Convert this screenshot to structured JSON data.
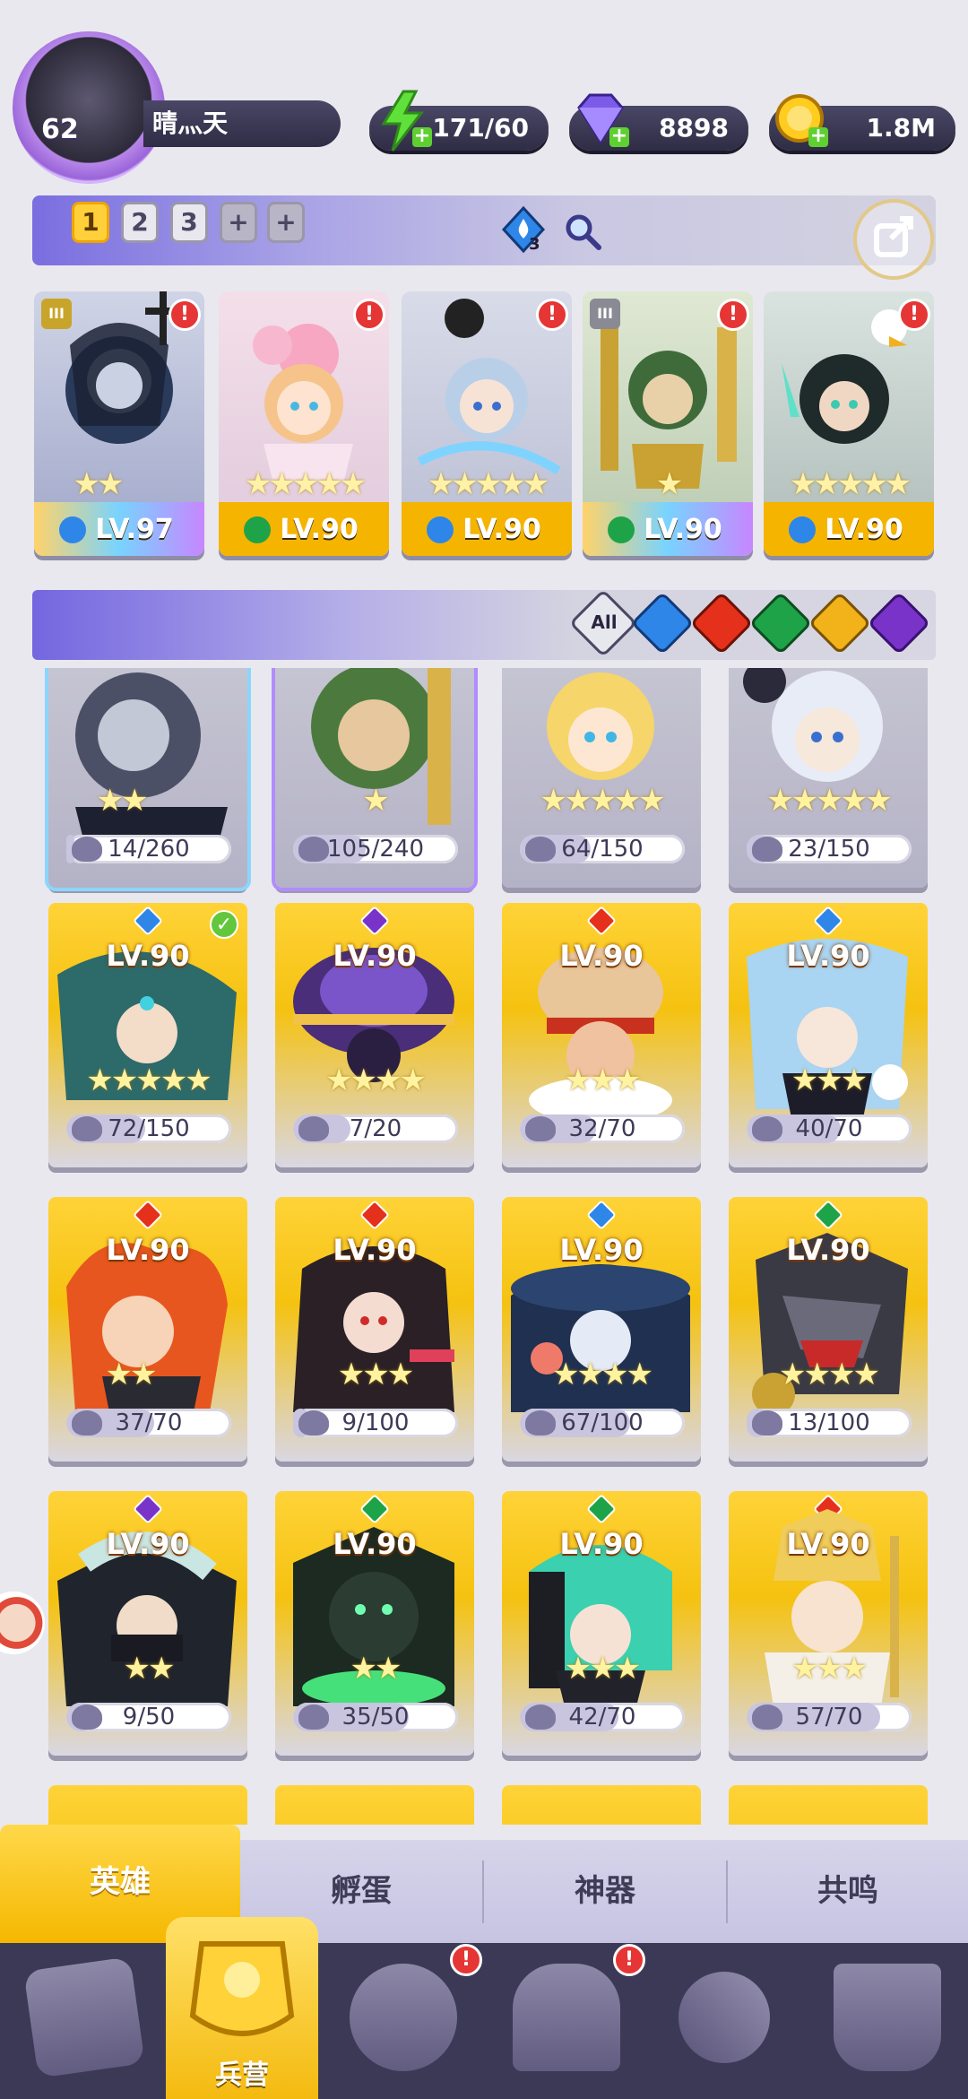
{
  "player": {
    "level": "62",
    "name": "晴灬天"
  },
  "resources": {
    "energy": "171/60",
    "gems": "8898",
    "gold": "1.8M"
  },
  "team_tabs": [
    "1",
    "2",
    "3",
    "+",
    "+"
  ],
  "filter_count": "3",
  "team": [
    {
      "level": "LV.97",
      "element": "water",
      "stars": 2,
      "alert": "!",
      "grade": "III"
    },
    {
      "level": "LV.90",
      "element": "wood",
      "stars": 5,
      "alert": "!"
    },
    {
      "level": "LV.90",
      "element": "water",
      "stars": 5,
      "alert": "!"
    },
    {
      "level": "LV.90",
      "element": "wood",
      "stars": 1,
      "alert": "!",
      "grade": "III"
    },
    {
      "level": "LV.90",
      "element": "water",
      "stars": 5,
      "alert": "!"
    }
  ],
  "element_filters": [
    "All",
    "water",
    "fire",
    "wood",
    "light",
    "dark"
  ],
  "heroes_top_row": [
    {
      "count": "14/260",
      "stars": 2
    },
    {
      "count": "105/240",
      "stars": 1
    },
    {
      "count": "64/150",
      "stars": 5
    },
    {
      "count": "23/150",
      "stars": 5
    }
  ],
  "heroes": [
    {
      "level": "LV.90",
      "element": "water",
      "count": "72/150",
      "stars": 5,
      "check": true
    },
    {
      "level": "LV.90",
      "element": "dark",
      "count": "7/20",
      "stars": 4
    },
    {
      "level": "LV.90",
      "element": "fire",
      "count": "32/70",
      "stars": 3
    },
    {
      "level": "LV.90",
      "element": "water",
      "count": "40/70",
      "stars": 3
    },
    {
      "level": "LV.90",
      "element": "fire",
      "count": "37/70",
      "stars": 2
    },
    {
      "level": "LV.90",
      "element": "fire",
      "count": "9/100",
      "stars": 3
    },
    {
      "level": "LV.90",
      "element": "water",
      "count": "67/100",
      "stars": 4
    },
    {
      "level": "LV.90",
      "element": "wood",
      "count": "13/100",
      "stars": 4
    },
    {
      "level": "LV.90",
      "element": "dark",
      "count": "9/50",
      "stars": 2
    },
    {
      "level": "LV.90",
      "element": "wood",
      "count": "35/50",
      "stars": 2
    },
    {
      "level": "LV.90",
      "element": "wood",
      "count": "42/70",
      "stars": 3
    },
    {
      "level": "LV.90",
      "element": "fire",
      "count": "57/70",
      "stars": 3
    }
  ],
  "tabs": [
    "英雄",
    "孵蛋",
    "神器",
    "共鸣"
  ],
  "nav": {
    "active_label": "兵营",
    "alert": "!"
  },
  "colors": {
    "water": "#2e86e8",
    "fire": "#e5301b",
    "wood": "#1fa348",
    "light": "#f2b31a",
    "dark": "#7a33c9",
    "accent": "#ffc81a"
  }
}
